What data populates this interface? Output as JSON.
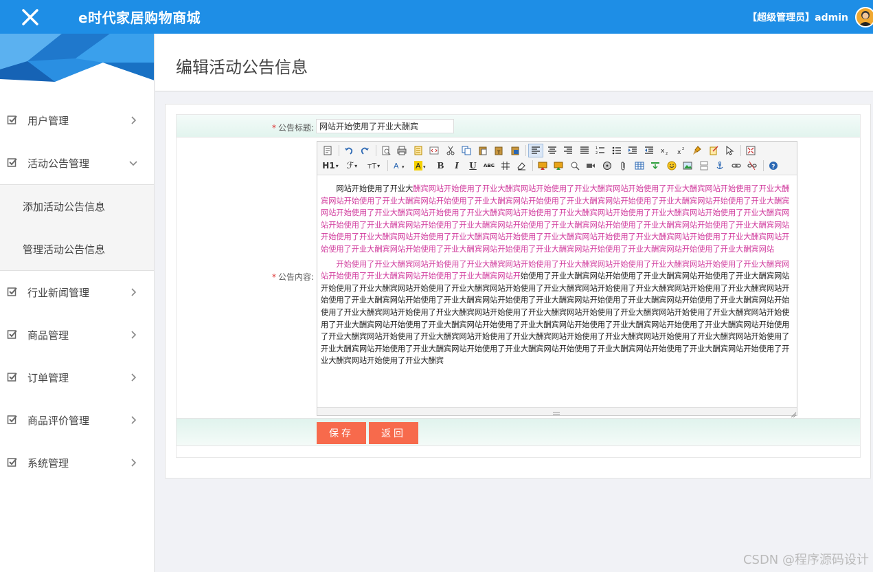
{
  "app": {
    "title": "e时代家居购物商城",
    "user_label": "【超级管理员】admin"
  },
  "sidebar": {
    "items": [
      {
        "label": "用户管理",
        "expanded": false
      },
      {
        "label": "活动公告管理",
        "expanded": true
      },
      {
        "label": "行业新闻管理",
        "expanded": false
      },
      {
        "label": "商品管理",
        "expanded": false
      },
      {
        "label": "订单管理",
        "expanded": false
      },
      {
        "label": "商品评价管理",
        "expanded": false
      },
      {
        "label": "系统管理",
        "expanded": false
      }
    ],
    "subitems": [
      {
        "label": "添加活动公告信息"
      },
      {
        "label": "管理活动公告信息"
      }
    ]
  },
  "page": {
    "title": "编辑活动公告信息"
  },
  "form": {
    "title_label": "公告标题:",
    "title_value": "网站开始使用了开业大酬宾",
    "content_label": "公告内容:",
    "para1_black": "网站开始使用了开业大",
    "para1_pink": "酬宾网站开始使用了开业大酬宾网站开始使用了开业大酬宾网站开始使用了开业大酬宾网站开始使用了开业大酬宾网站开始使用了开业大酬宾网站开始使用了开业大酬宾网站开始使用了开业大酬宾网站开始使用了开业大酬宾网站开始使用了开业大酬宾网站开始使用了开业大酬宾网站开始使用了开业大酬宾网站开始使用了开业大酬宾网站开始使用了开业大酬宾网站开始使用了开业大酬宾网站开始使用了开业大酬宾网站开始使用了开业大酬宾网站开始使用了开业大酬宾网站开始使用了开业大酬宾网站开始使用了开业大酬宾网站开始使用了开业大酬宾网站开始使用了开业大酬宾网站开始使用了开业大酬宾网站开始使用了开业大酬宾网站开始使用了开业大酬宾网站开始使用了开业大酬宾网站开始使用了开业大酬宾网站开始使用了开业大酬宾网站开始使用了开业大酬宾网站开始使用了开业大酬宾网站",
    "para2_pink": "开始使用了开业大酬宾网站开始使用了开业大酬宾网站开始使用了开业大酬宾网站开始使用了开业大酬宾网站开始使用了开业大酬宾网站开始使用了开业大酬宾网站开始使用了开业大酬宾网站开",
    "para2_black": "始使用了开业大酬宾网站开始使用了开业大酬宾网站开始使用了开业大酬宾网站开始使用了开业大酬宾网站开始使用了开业大酬宾网站开始使用了开业大酬宾网站开始使用了开业大酬宾网站开始使用了开业大酬宾网站开始使用了开业大酬宾网站开始使用了开业大酬宾网站开始使用了开业大酬宾网站开始使用了开业大酬宾网站开始使用了开业大酬宾网站开始使用了开业大酬宾网站开始使用了开业大酬宾网站开始使用了开业大酬宾网站开始使用了开业大酬宾网站开始使用了开业大酬宾网站开始使用了开业大酬宾网站开始使用了开业大酬宾网站开始使用了开业大酬宾网站开始使用了开业大酬宾网站开始使用了开业大酬宾网站开始使用了开业大酬宾网站开始使用了开业大酬宾网站开始使用了开业大酬宾网站开始使用了开业大酬宾网站开始使用了开业大酬宾网站开始使用了开业大酬宾网站开始使用了开业大酬宾网站开始使用了开业大酬宾网站开始使用了开业大酬宾网站开始使用了开业大酬宾网站开始使用了开业大酬宾网站开始使用了开业大酬宾",
    "save_label": "保存",
    "back_label": "返回"
  },
  "toolbar": {
    "heading_label": "H1",
    "font_label": "ℱ",
    "size_label": "ᴛT",
    "bold_label": "B",
    "italic_label": "I",
    "underline_label": "U",
    "strike_label": "ABC"
  },
  "watermark": "CSDN @程序源码设计",
  "colors": {
    "header": "#1e8ee6",
    "button": "#f76a4c",
    "pink_text": "#d0399c"
  }
}
